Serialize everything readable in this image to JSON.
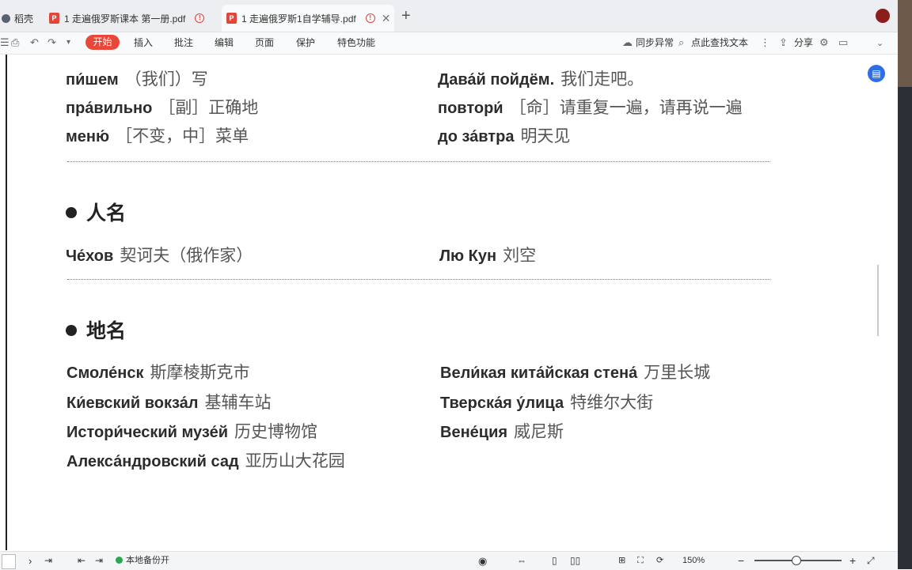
{
  "tabs": {
    "home_label": "稻壳",
    "tab1_label": "1 走遍俄罗斯课本 第一册.pdf",
    "tab2_label": "1 走遍俄罗斯1自学辅导.pdf"
  },
  "toolbar": {
    "start": "开始",
    "insert": "插入",
    "annotate": "批注",
    "edit": "编辑",
    "page": "页面",
    "protect": "保护",
    "special": "特色功能",
    "sync": "同步异常",
    "find": "点此查找文本",
    "share": "分享"
  },
  "content": {
    "vocab": [
      {
        "ru": "пи́шем",
        "zh": "（我们）写"
      },
      {
        "ru": "пра́вильно",
        "zh": "［副］正确地"
      },
      {
        "ru": "меню́",
        "zh": "［不变，中］菜单"
      }
    ],
    "vocab_right": [
      {
        "ru": "Дава́й пойдём.",
        "zh": "我们走吧。"
      },
      {
        "ru": "повтори́",
        "zh": "［命］请重复一遍，请再说一遍"
      },
      {
        "ru": "до за́втра",
        "zh": "明天见"
      }
    ],
    "names_heading": "人名",
    "names": [
      {
        "ru": "Че́хов",
        "zh": "契诃夫（俄作家）"
      },
      {
        "ru": "Лю Кун",
        "zh": "刘空"
      }
    ],
    "places_heading": "地名",
    "places_left": [
      {
        "ru": "Смоле́нск",
        "zh": "斯摩棱斯克市"
      },
      {
        "ru": "Ки́евский вокза́л",
        "zh": "基辅车站"
      },
      {
        "ru": "Истори́ческий музе́й",
        "zh": "历史博物馆"
      },
      {
        "ru": "Алекса́ндровский сад",
        "zh": "亚历山大花园"
      }
    ],
    "places_right": [
      {
        "ru": "Вели́кая кита́йская стена́",
        "zh": "万里长城"
      },
      {
        "ru": "Тверска́я у́лица",
        "zh": "特维尔大街"
      },
      {
        "ru": "Вене́ция",
        "zh": "威尼斯"
      }
    ]
  },
  "statusbar": {
    "backup": "本地备份开",
    "zoom": "150%"
  },
  "colors": {
    "accent": "#e8473a",
    "float": "#2f6fe6"
  }
}
